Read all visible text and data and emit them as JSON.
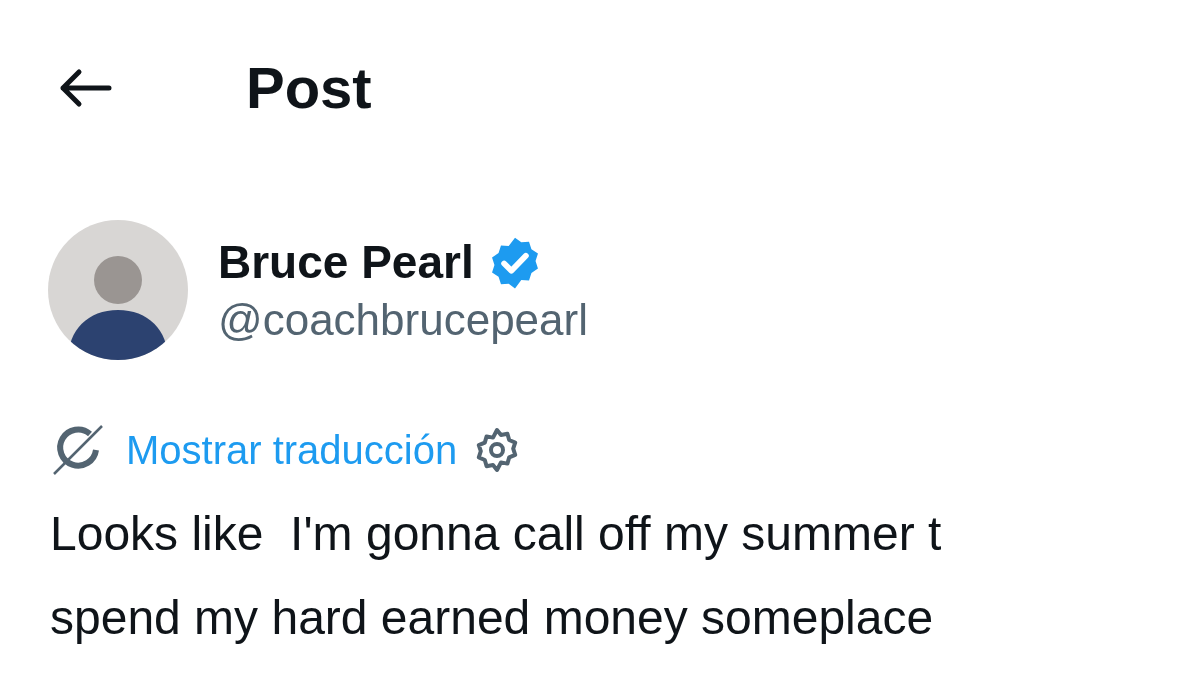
{
  "header": {
    "title": "Post"
  },
  "author": {
    "name": "Bruce Pearl",
    "verified": true,
    "handle": "@coachbrucepearl"
  },
  "translate": {
    "label": "Mostrar traducción"
  },
  "body_lines": [
    "Looks like  I'm gonna call off my summer t",
    "spend my hard earned money someplace"
  ]
}
